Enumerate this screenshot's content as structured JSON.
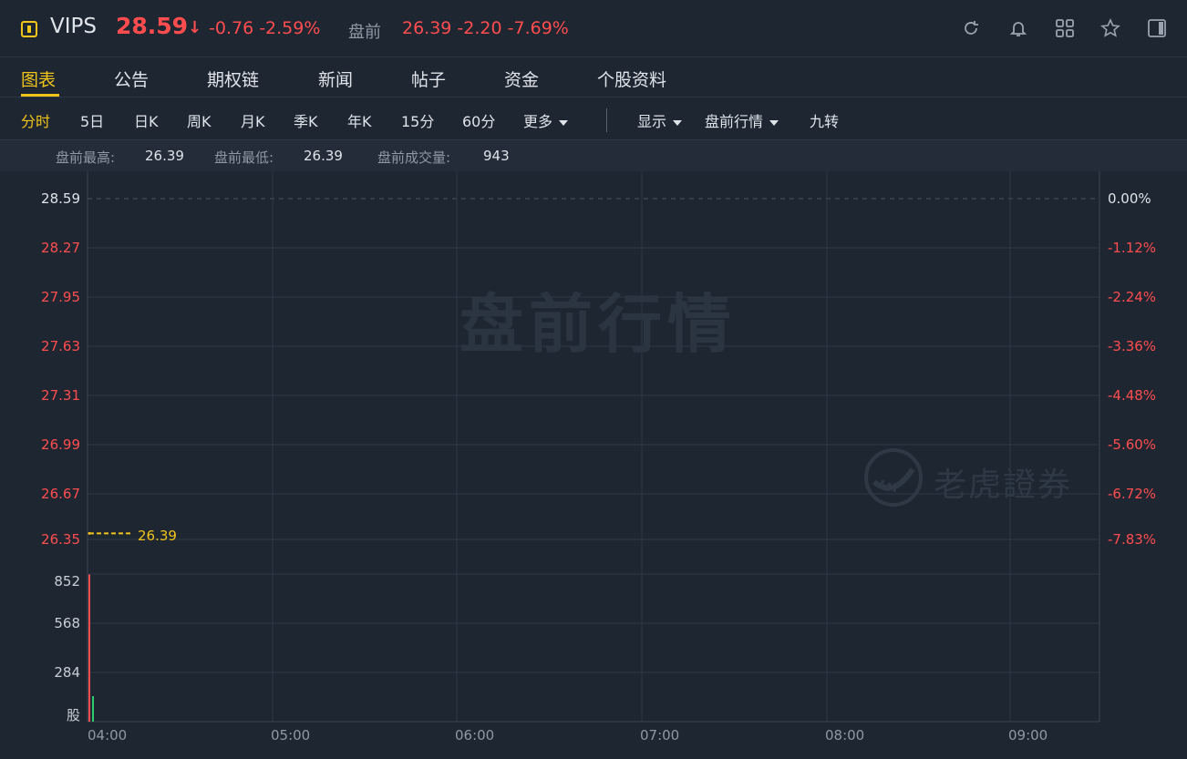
{
  "header": {
    "ticker": "VIPS",
    "price": "28.59",
    "change": "-0.76 -2.59%",
    "premarket_label": "盘前",
    "premarket_values": "26.39 -2.20 -7.69%",
    "icons": [
      "refresh-icon",
      "bell-icon",
      "grid-icon",
      "star-icon",
      "panel-icon"
    ]
  },
  "tabs": [
    "图表",
    "公告",
    "期权链",
    "新闻",
    "帖子",
    "资金",
    "个股资料"
  ],
  "periods": {
    "items": [
      "分时",
      "5日",
      "日K",
      "周K",
      "月K",
      "季K",
      "年K",
      "15分",
      "60分"
    ],
    "more": "更多",
    "display": "显示",
    "premarket": "盘前行情",
    "nine": "九转"
  },
  "stats": {
    "high_label": "盘前最高:",
    "high": "26.39",
    "low_label": "盘前最低:",
    "low": "26.39",
    "vol_label": "盘前成交量:",
    "vol": "943"
  },
  "chart_data": {
    "type": "line",
    "title": "",
    "y_price_ticks": [
      "28.59",
      "28.27",
      "27.95",
      "27.63",
      "27.31",
      "26.99",
      "26.67",
      "26.35"
    ],
    "y_pct_ticks": [
      "0.00%",
      "-1.12%",
      "-2.24%",
      "-3.36%",
      "-4.48%",
      "-5.60%",
      "-6.72%",
      "-7.83%"
    ],
    "volume_ticks": [
      "852",
      "568",
      "284",
      "股"
    ],
    "x_ticks": [
      "04:00",
      "05:00",
      "06:00",
      "07:00",
      "08:00",
      "09:00"
    ],
    "prev_close": 28.59,
    "last_price_label": "26.39",
    "series": [
      {
        "values": [
          26.39
        ]
      }
    ],
    "volume": [
      {
        "x": "04:00",
        "values": [
          900,
          60
        ]
      }
    ],
    "watermark": "盘前行情",
    "brand": "老虎證券"
  },
  "colors": {
    "up": "#ff4d4f",
    "accent": "#f0c419",
    "bg": "#1e2631"
  }
}
